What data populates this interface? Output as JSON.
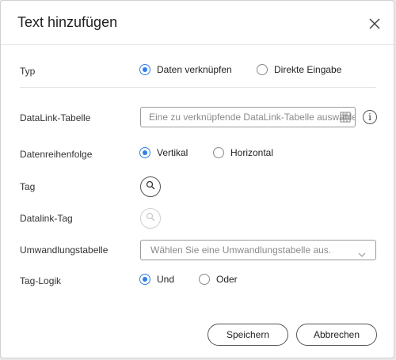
{
  "dialog": {
    "title": "Text hinzufügen",
    "close_icon": "close-icon"
  },
  "typ": {
    "label": "Typ",
    "options": [
      "Daten verknüpfen",
      "Direkte Eingabe"
    ],
    "selected": "Daten verknüpfen"
  },
  "datalink_table": {
    "label": "DataLink-Tabelle",
    "placeholder": "Eine zu verknüpfende DataLink-Tabelle auswählen.",
    "table_icon": "table-icon",
    "info_glyph": "i"
  },
  "data_order": {
    "label": "Datenreihenfolge",
    "options": [
      "Vertikal",
      "Horizontal"
    ],
    "selected": "Vertikal"
  },
  "tag": {
    "label": "Tag",
    "icon": "search-icon"
  },
  "datalink_tag": {
    "label": "Datalink-Tag",
    "icon": "search-icon",
    "enabled": false
  },
  "conversion_table": {
    "label": "Umwandlungstabelle",
    "placeholder": "Wählen Sie eine Umwandlungstabelle aus.",
    "icon": "chevron-down-icon"
  },
  "tag_logic": {
    "label": "Tag-Logik",
    "options": [
      "Und",
      "Oder"
    ],
    "selected": "Und"
  },
  "footer": {
    "save_label": "Speichern",
    "cancel_label": "Abbrechen"
  },
  "colors": {
    "accent": "#2f7fe6",
    "border": "#9a9a9a",
    "text": "#222222"
  }
}
